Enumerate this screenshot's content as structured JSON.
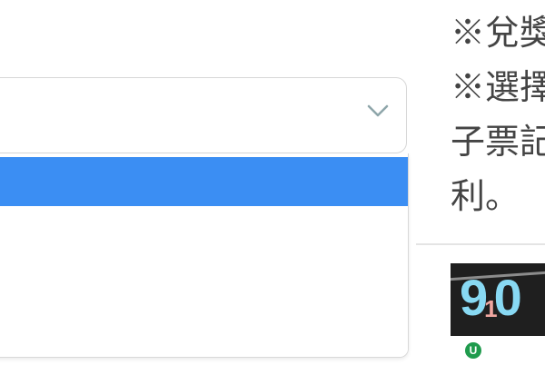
{
  "right_text": {
    "lines": [
      "※兌獎",
      "※選擇",
      "子票記",
      "利。"
    ]
  },
  "badge": {
    "text_left": "9",
    "text_small": "1",
    "text_right": "0"
  },
  "u_icon": {
    "label": "U"
  },
  "dropdown": {
    "highlight_color": "#3b8ef3"
  }
}
